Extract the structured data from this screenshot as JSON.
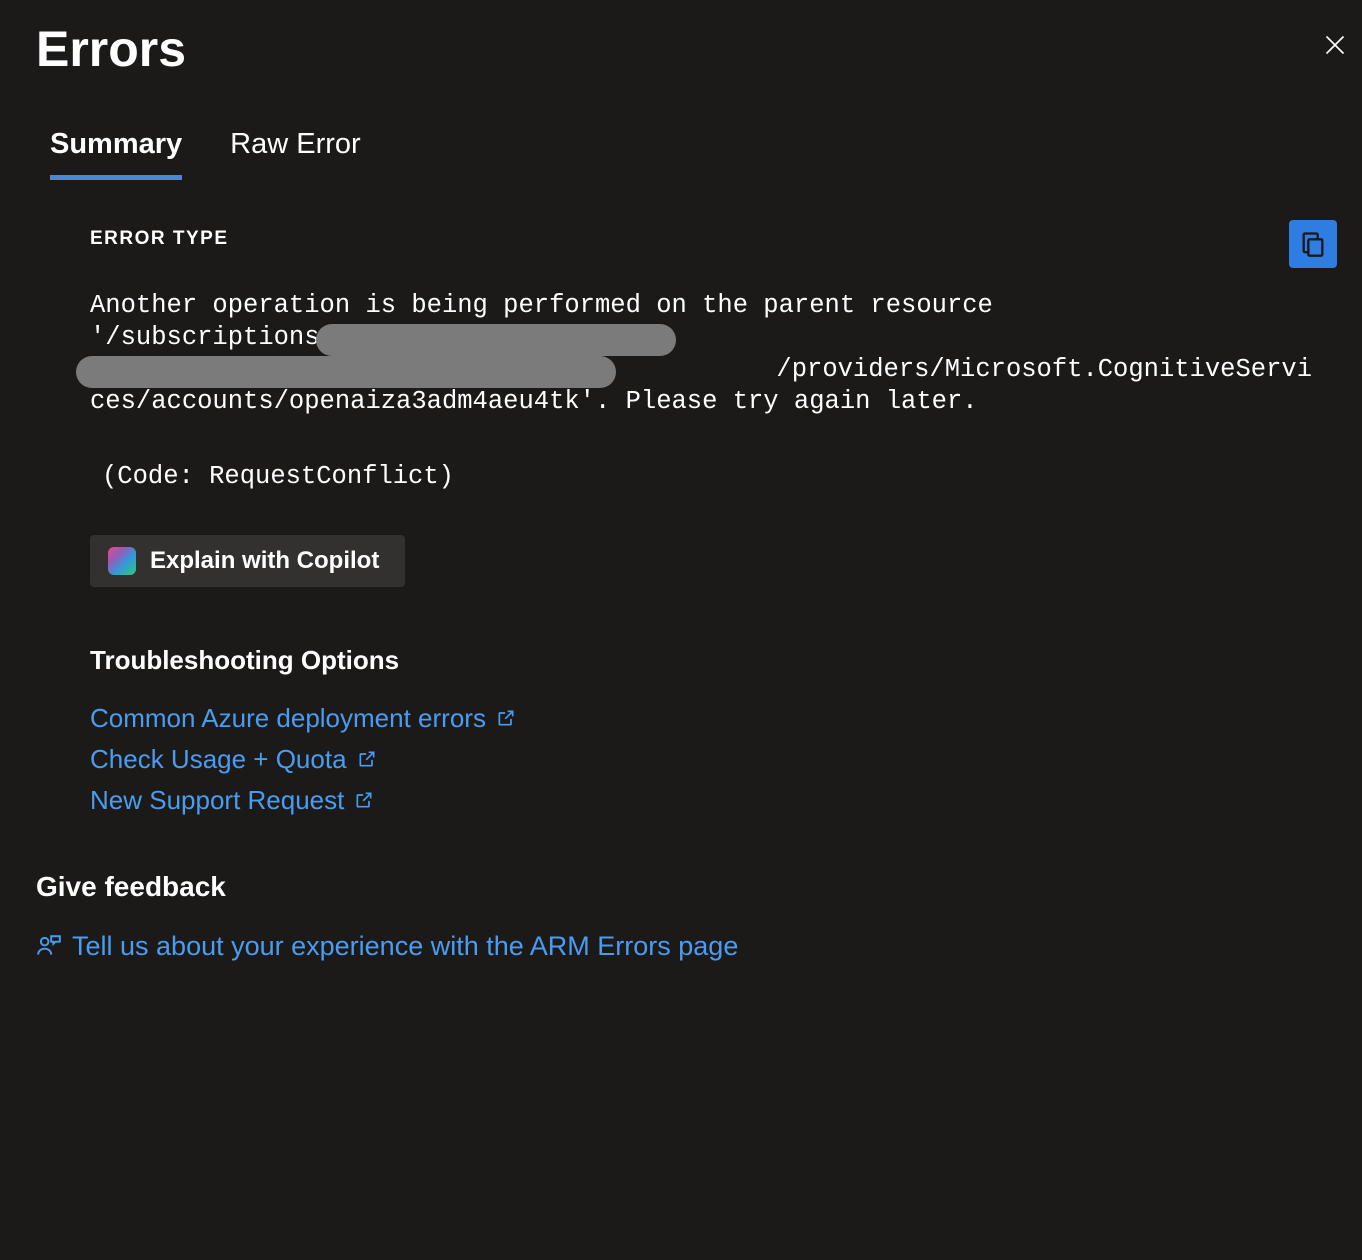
{
  "header": {
    "title": "Errors"
  },
  "tabs": {
    "summary": "Summary",
    "raw_error": "Raw Error"
  },
  "error": {
    "type_label": "ERROR TYPE",
    "message_line1": "Another operation is being performed on the parent resource",
    "message_line2": "'/subscriptions",
    "message_line3": "/providers/Microsoft.CognitiveServi",
    "message_line4": "ces/accounts/openaiza3adm4aeu4tk'. Please try again later.",
    "code": " (Code: RequestConflict)"
  },
  "copilot": {
    "label": "Explain with Copilot"
  },
  "troubleshooting": {
    "heading": "Troubleshooting Options",
    "links": [
      "Common Azure deployment errors",
      "Check Usage + Quota",
      "New Support Request"
    ]
  },
  "feedback": {
    "heading": "Give feedback",
    "link_text": "Tell us about your experience with the ARM Errors page"
  }
}
